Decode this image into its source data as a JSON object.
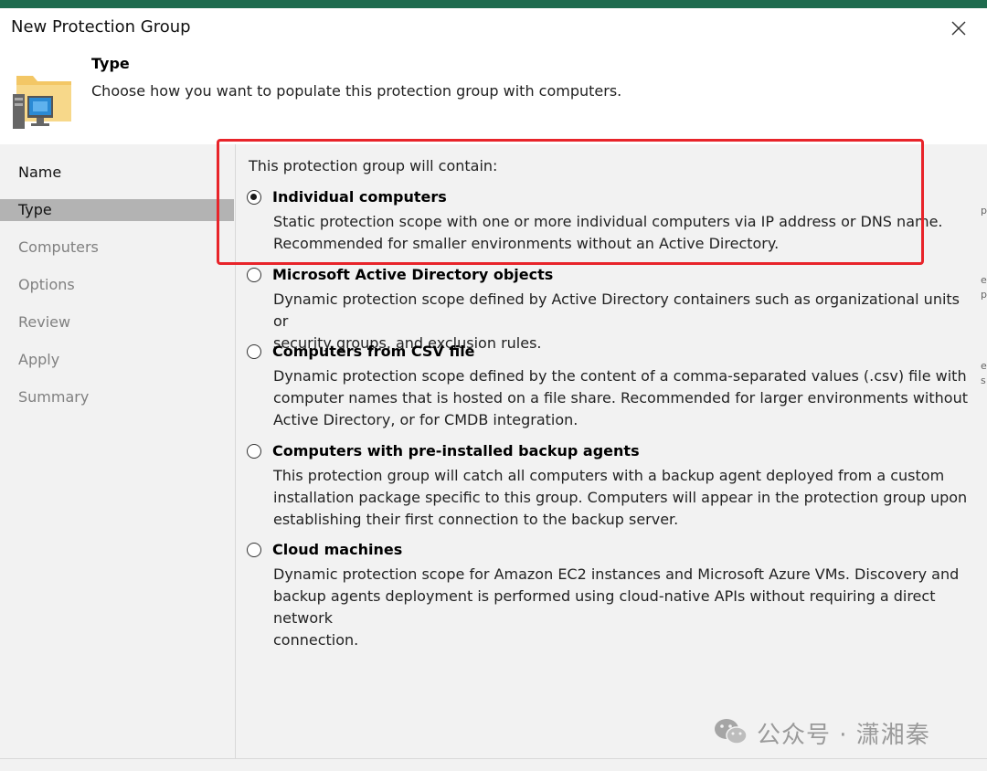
{
  "window": {
    "title": "New Protection Group"
  },
  "header": {
    "title": "Type",
    "subtitle": "Choose how you want to populate this protection group with computers."
  },
  "steps": [
    {
      "label": "Name",
      "state": "done"
    },
    {
      "label": "Type",
      "state": "active"
    },
    {
      "label": "Computers",
      "state": "pending"
    },
    {
      "label": "Options",
      "state": "pending"
    },
    {
      "label": "Review",
      "state": "pending"
    },
    {
      "label": "Apply",
      "state": "pending"
    },
    {
      "label": "Summary",
      "state": "pending"
    }
  ],
  "content": {
    "intro": "This protection group will contain:",
    "options": [
      {
        "label": "Individual computers",
        "checked": true,
        "lines": [
          "Static protection scope with one or more individual computers via IP address or DNS name.",
          "Recommended for smaller environments without an Active Directory."
        ]
      },
      {
        "label": "Microsoft Active Directory objects",
        "checked": false,
        "lines": [
          "Dynamic protection scope defined by Active Directory containers such as organizational units or",
          "security groups, and exclusion rules."
        ]
      },
      {
        "label": "Computers from CSV file",
        "checked": false,
        "lines": [
          "Dynamic protection scope defined by the content of a comma-separated values (.csv) file with",
          "computer names that is hosted on a file share. Recommended for larger environments without",
          "Active Directory, or for CMDB integration."
        ]
      },
      {
        "label": "Computers with pre-installed backup agents",
        "checked": false,
        "lines": [
          "This protection group will catch all computers with a backup agent deployed from a custom",
          "installation package specific to this group.  Computers will appear in the protection group upon",
          "establishing their first connection to the backup server."
        ]
      },
      {
        "label": "Cloud machines",
        "checked": false,
        "lines": [
          "Dynamic protection scope for Amazon EC2 instances and Microsoft Azure VMs. Discovery and",
          "backup agents deployment is performed using cloud-native APIs without requiring a direct network",
          "connection."
        ]
      }
    ]
  },
  "watermark": {
    "text": "公众号 · 潇湘秦"
  },
  "icons": {
    "close": "close-icon",
    "header": "folder-computer-icon",
    "watermark": "wechat-icon"
  },
  "colors": {
    "highlight": "#e8242a",
    "top_strip": "#1e6b4e",
    "active_step_bg": "#b3b3b3",
    "panel_bg": "#f2f2f2"
  }
}
